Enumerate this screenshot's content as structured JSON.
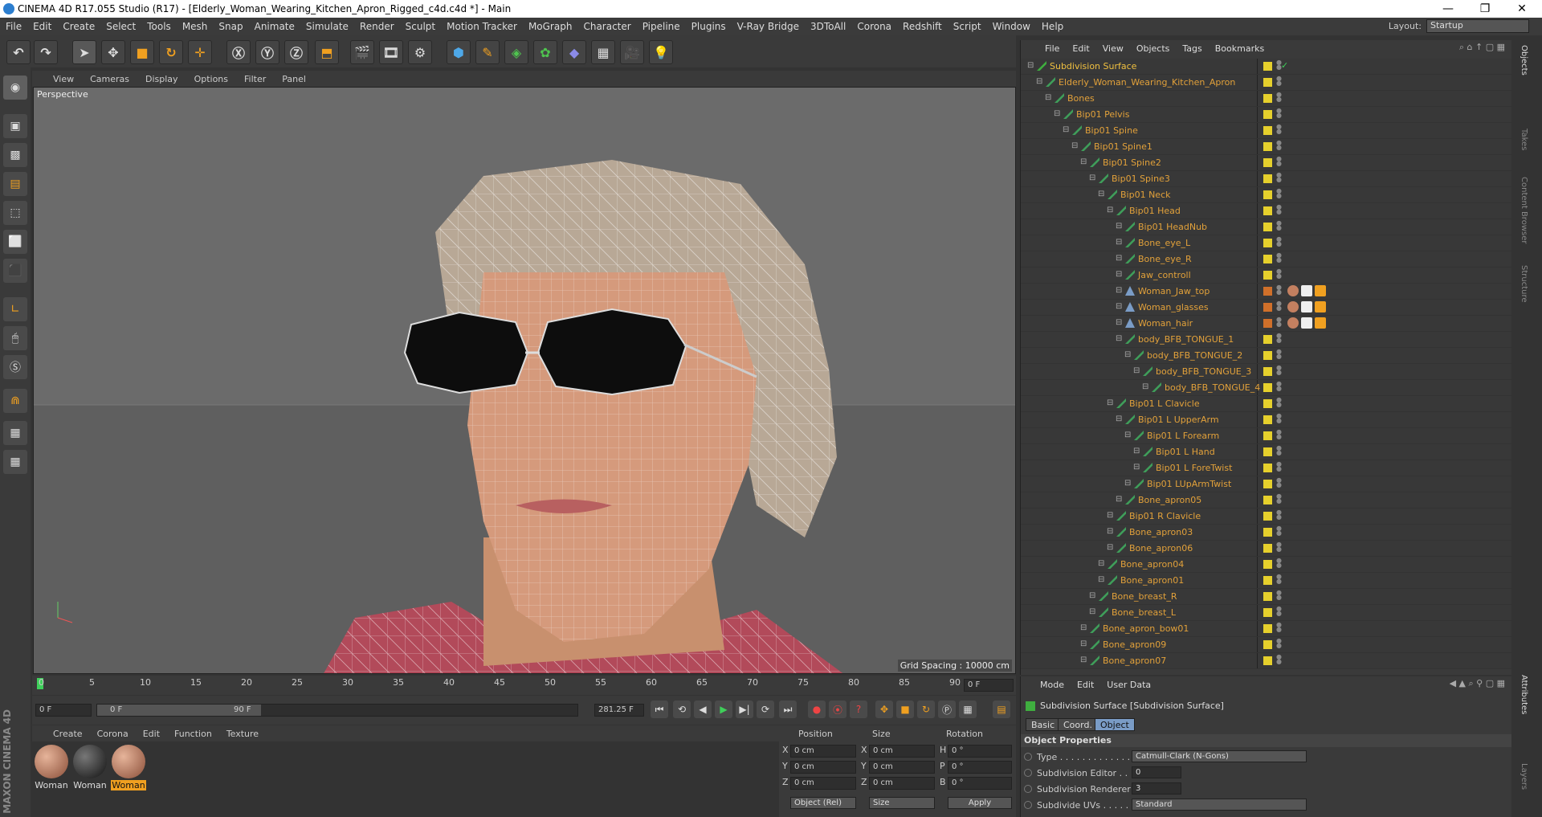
{
  "window": {
    "title": "CINEMA 4D R17.055 Studio (R17) - [Elderly_Woman_Wearing_Kitchen_Apron_Rigged_c4d.c4d *] - Main",
    "minimize": "—",
    "maximize": "❐",
    "close": "✕"
  },
  "menubar": [
    "File",
    "Edit",
    "Create",
    "Select",
    "Tools",
    "Mesh",
    "Snap",
    "Animate",
    "Simulate",
    "Render",
    "Sculpt",
    "Motion Tracker",
    "MoGraph",
    "Character",
    "Pipeline",
    "Plugins",
    "V-Ray Bridge",
    "3DToAll",
    "Corona",
    "Redshift",
    "Script",
    "Window",
    "Help"
  ],
  "layout": {
    "label": "Layout:",
    "value": "Startup"
  },
  "viewport": {
    "menu": [
      "View",
      "Cameras",
      "Display",
      "Options",
      "Filter",
      "Panel"
    ],
    "label": "Perspective",
    "grid_spacing": "Grid Spacing : 10000 cm"
  },
  "timeline": {
    "ticks": [
      "0",
      "5",
      "10",
      "15",
      "20",
      "25",
      "30",
      "35",
      "40",
      "45",
      "50",
      "55",
      "60",
      "65",
      "70",
      "75",
      "80",
      "85",
      "90"
    ],
    "current_frame": "0 F"
  },
  "transport": {
    "start": "0 F",
    "range_start": "0 F",
    "range_end": "90 F",
    "fps": "281.25 F"
  },
  "materials": {
    "menu": [
      "Create",
      "Corona",
      "Edit",
      "Function",
      "Texture"
    ],
    "items": [
      "Woman",
      "Woman",
      "Woman"
    ]
  },
  "coord": {
    "headers": [
      "Position",
      "Size",
      "Rotation"
    ],
    "rows": [
      {
        "a": "X",
        "pos": "0 cm",
        "b": "X",
        "size": "0 cm",
        "c": "H",
        "rot": "0 °"
      },
      {
        "a": "Y",
        "pos": "0 cm",
        "b": "Y",
        "size": "0 cm",
        "c": "P",
        "rot": "0 °"
      },
      {
        "a": "Z",
        "pos": "0 cm",
        "b": "Z",
        "size": "0 cm",
        "c": "B",
        "rot": "0 °"
      }
    ],
    "mode": "Object (Rel)",
    "size_mode": "Size",
    "apply": "Apply"
  },
  "object_manager": {
    "menu": [
      "File",
      "Edit",
      "View",
      "Objects",
      "Tags",
      "Bookmarks"
    ],
    "rows": [
      {
        "name": "Subdivision Surface",
        "depth": 0,
        "color": "#e6d02c"
      },
      {
        "name": "Elderly_Woman_Wearing_Kitchen_Apron",
        "depth": 1,
        "color": "#e6d02c"
      },
      {
        "name": "Bones",
        "depth": 2,
        "color": "#e6d02c"
      },
      {
        "name": "Bip01 Pelvis",
        "depth": 3,
        "color": "#e6d02c"
      },
      {
        "name": "Bip01 Spine",
        "depth": 4,
        "color": "#e6d02c"
      },
      {
        "name": "Bip01 Spine1",
        "depth": 5,
        "color": "#e6d02c"
      },
      {
        "name": "Bip01 Spine2",
        "depth": 6,
        "color": "#e6d02c"
      },
      {
        "name": "Bip01 Spine3",
        "depth": 7,
        "color": "#e6d02c"
      },
      {
        "name": "Bip01 Neck",
        "depth": 8,
        "color": "#e6d02c"
      },
      {
        "name": "Bip01 Head",
        "depth": 9,
        "color": "#e6d02c"
      },
      {
        "name": "Bip01 HeadNub",
        "depth": 10,
        "color": "#e6d02c"
      },
      {
        "name": "Bone_eye_L",
        "depth": 10,
        "color": "#e6d02c"
      },
      {
        "name": "Bone_eye_R",
        "depth": 10,
        "color": "#e6d02c"
      },
      {
        "name": "Jaw_controll",
        "depth": 10,
        "color": "#e6d02c"
      },
      {
        "name": "Woman_Jaw_top",
        "depth": 10,
        "color": "#d0702a"
      },
      {
        "name": "Woman_glasses",
        "depth": 10,
        "color": "#d0702a"
      },
      {
        "name": "Woman_hair",
        "depth": 10,
        "color": "#d0702a"
      },
      {
        "name": "body_BFB_TONGUE_1",
        "depth": 10,
        "color": "#e6d02c"
      },
      {
        "name": "body_BFB_TONGUE_2",
        "depth": 11,
        "color": "#e6d02c"
      },
      {
        "name": "body_BFB_TONGUE_3",
        "depth": 12,
        "color": "#e6d02c"
      },
      {
        "name": "body_BFB_TONGUE_4",
        "depth": 13,
        "color": "#e6d02c"
      },
      {
        "name": "Bip01 L Clavicle",
        "depth": 9,
        "color": "#e6d02c"
      },
      {
        "name": "Bip01 L UpperArm",
        "depth": 10,
        "color": "#e6d02c"
      },
      {
        "name": "Bip01 L Forearm",
        "depth": 11,
        "color": "#e6d02c"
      },
      {
        "name": "Bip01 L Hand",
        "depth": 12,
        "color": "#e6d02c"
      },
      {
        "name": "Bip01 L ForeTwist",
        "depth": 12,
        "color": "#e6d02c"
      },
      {
        "name": "Bip01 LUpArmTwist",
        "depth": 11,
        "color": "#e6d02c"
      },
      {
        "name": "Bone_apron05",
        "depth": 10,
        "color": "#e6d02c"
      },
      {
        "name": "Bip01 R Clavicle",
        "depth": 9,
        "color": "#e6d02c"
      },
      {
        "name": "Bone_apron03",
        "depth": 9,
        "color": "#e6d02c"
      },
      {
        "name": "Bone_apron06",
        "depth": 9,
        "color": "#e6d02c"
      },
      {
        "name": "Bone_apron04",
        "depth": 8,
        "color": "#e6d02c"
      },
      {
        "name": "Bone_apron01",
        "depth": 8,
        "color": "#e6d02c"
      },
      {
        "name": "Bone_breast_R",
        "depth": 7,
        "color": "#e6d02c"
      },
      {
        "name": "Bone_breast_L",
        "depth": 7,
        "color": "#e6d02c"
      },
      {
        "name": "Bone_apron_bow01",
        "depth": 6,
        "color": "#e6d02c"
      },
      {
        "name": "Bone_apron09",
        "depth": 6,
        "color": "#e6d02c"
      },
      {
        "name": "Bone_apron07",
        "depth": 6,
        "color": "#e6d02c"
      }
    ]
  },
  "attributes": {
    "menu": [
      "Mode",
      "Edit",
      "User Data"
    ],
    "title": "Subdivision Surface [Subdivision Surface]",
    "tabs": [
      "Basic",
      "Coord.",
      "Object"
    ],
    "section": "Object Properties",
    "type_label": "Type . . . . . . . . . . . . . . .",
    "type_value": "Catmull-Clark (N-Gons)",
    "editor_label": "Subdivision Editor . .",
    "editor_value": "0",
    "renderer_label": "Subdivision Renderer",
    "renderer_value": "3",
    "uvs_label": "Subdivide UVs . . . . . . .",
    "uvs_value": "Standard"
  },
  "right_tabs": [
    "Objects",
    "Takes",
    "Content Browser",
    "Structure",
    "Attributes",
    "Layers"
  ],
  "brand": "MAXON CINEMA 4D"
}
